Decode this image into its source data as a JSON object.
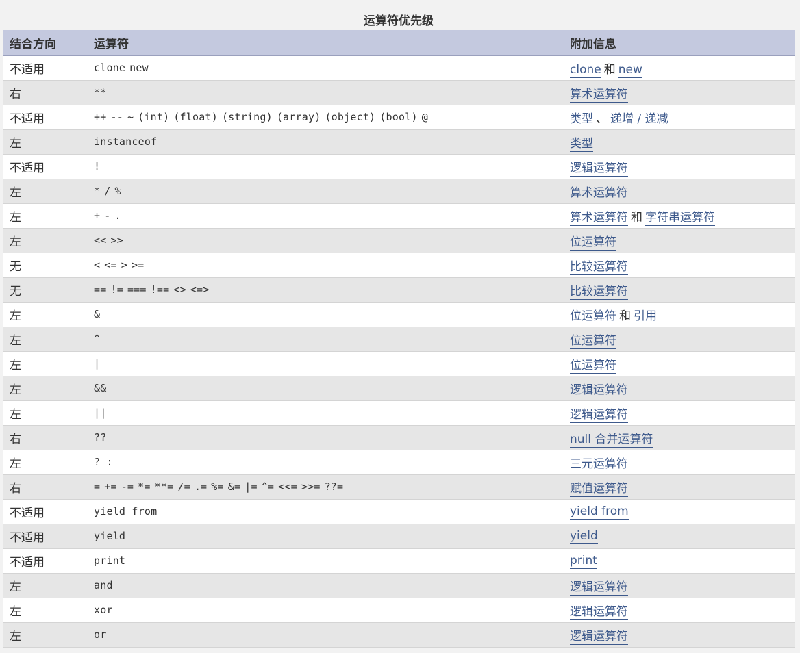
{
  "caption": "运算符优先级",
  "headers": {
    "assoc": "结合方向",
    "op": "运算符",
    "info": "附加信息"
  },
  "rows": [
    {
      "assoc": "不适用",
      "op": [
        "clone",
        "new"
      ],
      "info": [
        {
          "t": "link",
          "v": "clone"
        },
        {
          "t": "text",
          "v": "和"
        },
        {
          "t": "link",
          "v": "new"
        }
      ]
    },
    {
      "assoc": "右",
      "op": [
        "**"
      ],
      "info": [
        {
          "t": "link",
          "v": "算术运算符"
        }
      ]
    },
    {
      "assoc": "不适用",
      "op": [
        "++",
        "--",
        "~",
        "(int)",
        "(float)",
        "(string)",
        "(array)",
        "(object)",
        "(bool)",
        "@"
      ],
      "info": [
        {
          "t": "link",
          "v": "类型"
        },
        {
          "t": "text",
          "v": "、"
        },
        {
          "t": "link",
          "v": "递增 / 递减"
        }
      ]
    },
    {
      "assoc": "左",
      "op": [
        "instanceof"
      ],
      "info": [
        {
          "t": "link",
          "v": "类型"
        }
      ]
    },
    {
      "assoc": "不适用",
      "op": [
        "!"
      ],
      "info": [
        {
          "t": "link",
          "v": "逻辑运算符"
        }
      ]
    },
    {
      "assoc": "左",
      "op": [
        "*",
        "/",
        "%"
      ],
      "info": [
        {
          "t": "link",
          "v": "算术运算符"
        }
      ]
    },
    {
      "assoc": "左",
      "op": [
        "+",
        "-",
        "."
      ],
      "info": [
        {
          "t": "link",
          "v": "算术运算符"
        },
        {
          "t": "text",
          "v": "和"
        },
        {
          "t": "link",
          "v": "字符串运算符"
        }
      ]
    },
    {
      "assoc": "左",
      "op": [
        "<<",
        ">>"
      ],
      "info": [
        {
          "t": "link",
          "v": "位运算符"
        }
      ]
    },
    {
      "assoc": "无",
      "op": [
        "<",
        "<=",
        ">",
        ">="
      ],
      "info": [
        {
          "t": "link",
          "v": "比较运算符"
        }
      ]
    },
    {
      "assoc": "无",
      "op": [
        "==",
        "!=",
        "===",
        "!==",
        "<>",
        "<=>"
      ],
      "info": [
        {
          "t": "link",
          "v": "比较运算符"
        }
      ]
    },
    {
      "assoc": "左",
      "op": [
        "&"
      ],
      "info": [
        {
          "t": "link",
          "v": "位运算符"
        },
        {
          "t": "text",
          "v": "和"
        },
        {
          "t": "link",
          "v": "引用"
        }
      ]
    },
    {
      "assoc": "左",
      "op": [
        "^"
      ],
      "info": [
        {
          "t": "link",
          "v": "位运算符"
        }
      ]
    },
    {
      "assoc": "左",
      "op": [
        "|"
      ],
      "info": [
        {
          "t": "link",
          "v": "位运算符"
        }
      ]
    },
    {
      "assoc": "左",
      "op": [
        "&&"
      ],
      "info": [
        {
          "t": "link",
          "v": "逻辑运算符"
        }
      ]
    },
    {
      "assoc": "左",
      "op": [
        "||"
      ],
      "info": [
        {
          "t": "link",
          "v": "逻辑运算符"
        }
      ]
    },
    {
      "assoc": "右",
      "op": [
        "??"
      ],
      "info": [
        {
          "t": "link",
          "v": "null 合并运算符"
        }
      ]
    },
    {
      "assoc": "左",
      "op": [
        "? :"
      ],
      "info": [
        {
          "t": "link",
          "v": "三元运算符"
        }
      ]
    },
    {
      "assoc": "右",
      "op": [
        "=",
        "+=",
        "-=",
        "*=",
        "**=",
        "/=",
        ".=",
        "%=",
        "&=",
        "|=",
        "^=",
        "<<=",
        ">>=",
        "??="
      ],
      "info": [
        {
          "t": "link",
          "v": "赋值运算符"
        }
      ]
    },
    {
      "assoc": "不适用",
      "op": [
        "yield from"
      ],
      "info": [
        {
          "t": "link",
          "v": "yield from"
        }
      ]
    },
    {
      "assoc": "不适用",
      "op": [
        "yield"
      ],
      "info": [
        {
          "t": "link",
          "v": "yield"
        }
      ]
    },
    {
      "assoc": "不适用",
      "op": [
        "print"
      ],
      "info": [
        {
          "t": "link",
          "v": "print"
        }
      ]
    },
    {
      "assoc": "左",
      "op": [
        "and"
      ],
      "info": [
        {
          "t": "link",
          "v": "逻辑运算符"
        }
      ]
    },
    {
      "assoc": "左",
      "op": [
        "xor"
      ],
      "info": [
        {
          "t": "link",
          "v": "逻辑运算符"
        }
      ]
    },
    {
      "assoc": "左",
      "op": [
        "or"
      ],
      "info": [
        {
          "t": "link",
          "v": "逻辑运算符"
        }
      ]
    }
  ]
}
